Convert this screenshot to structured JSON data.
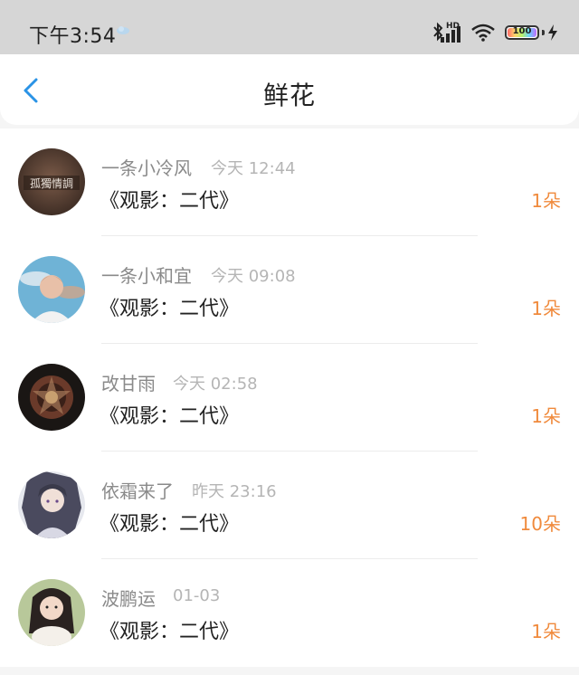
{
  "status_bar": {
    "time": "下午3:54",
    "network": "HD",
    "battery": "100"
  },
  "header": {
    "title": "鲜花"
  },
  "colors": {
    "accent_blue": "#2a93e6",
    "count_orange": "#f08a3c"
  },
  "records": [
    {
      "user": "一条小冷风",
      "time": "今天 12:44",
      "gift": "《观影：二代》",
      "count": "1朵",
      "avatar_text": "孤獨情調"
    },
    {
      "user": "一条小和宜",
      "time": "今天 09:08",
      "gift": "《观影：二代》",
      "count": "1朵"
    },
    {
      "user": "改甘雨",
      "time": "今天 02:58",
      "gift": "《观影：二代》",
      "count": "1朵"
    },
    {
      "user": "依霜来了",
      "time": "昨天 23:16",
      "gift": "《观影：二代》",
      "count": "10朵"
    },
    {
      "user": "波鹏运",
      "time": "01-03",
      "gift": "《观影：二代》",
      "count": "1朵"
    }
  ]
}
